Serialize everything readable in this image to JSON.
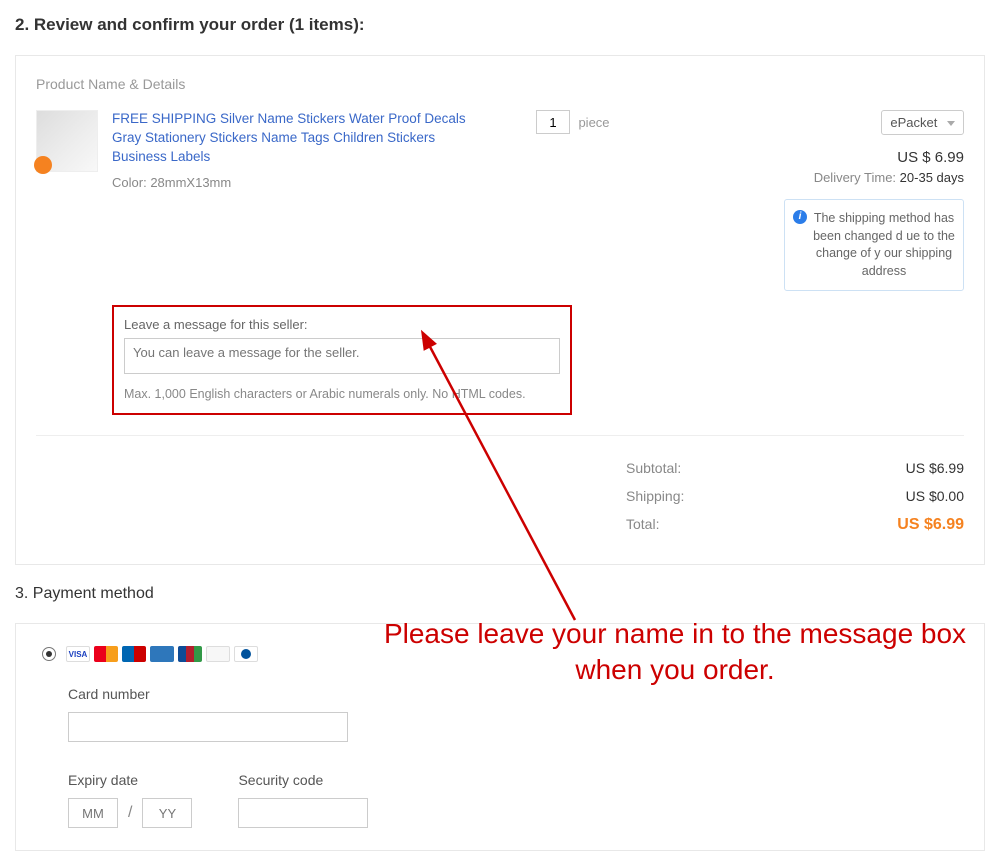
{
  "section2": {
    "title": "2. Review and confirm your order (1 items):",
    "product_header": "Product Name & Details",
    "product_title": "FREE SHIPPING Silver Name Stickers Water Proof Decals Gray Stationery Stickers Name Tags Children Stickers Business Labels",
    "color_label": "Color:",
    "color_value": "28mmX13mm",
    "qty_value": "1",
    "qty_unit": "piece",
    "ship_method": "ePacket",
    "price": "US  $ 6.99",
    "delivery_label": "Delivery Time:",
    "delivery_value": "20-35 days",
    "msg_label": "Leave a message for this seller:",
    "msg_placeholder": "You can leave a message for the seller.",
    "msg_hint": "Max. 1,000 English characters or Arabic numerals only. No HTML codes.",
    "info_bubble": "The shipping method has been changed d ue to the change of y our shipping address",
    "subtotal_label": "Subtotal:",
    "subtotal_value": "US $6.99",
    "shipping_label": "Shipping:",
    "shipping_value": "US $0.00",
    "total_label": "Total:",
    "total_value": "US $6.99"
  },
  "section3": {
    "title": "3. Payment method",
    "visa_text": "VISA",
    "card_number_label": "Card number",
    "expiry_label": "Expiry date",
    "security_label": "Security code",
    "mm": "MM",
    "yy": "YY",
    "slash": "/"
  },
  "annotation": {
    "text": "Please leave your name in to the message box when you order."
  }
}
